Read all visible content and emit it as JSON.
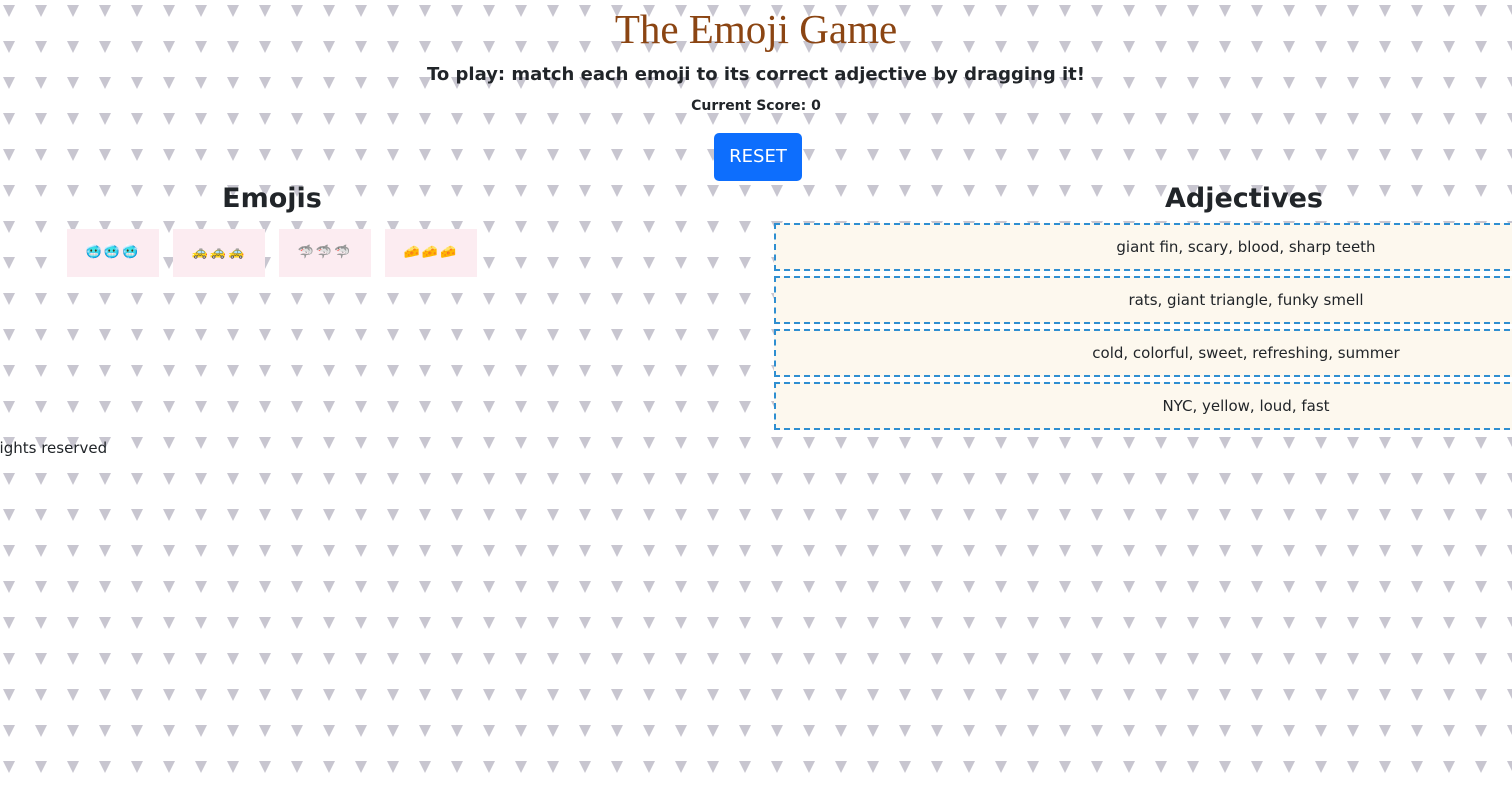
{
  "header": {
    "title": "The Emoji Game",
    "instructions": "To play: match each emoji to its correct adjective by dragging it!",
    "score": "Current Score: 0",
    "reset_label": "RESET"
  },
  "emojis": {
    "heading": "Emojis",
    "tiles": [
      {
        "text": "🥶🥶🥶",
        "name": "cold-face"
      },
      {
        "text": "🚕🚕🚕",
        "name": "taxi"
      },
      {
        "text": "🦈🦈🦈",
        "name": "shark"
      },
      {
        "text": "🧀🧀🧀",
        "name": "cheese"
      }
    ]
  },
  "adjectives": {
    "heading": "Adjectives",
    "items": [
      "giant fin, scary, blood, sharp teeth",
      "rats, giant triangle, funky smell",
      "cold, colorful, sweet, refreshing, summer",
      "NYC, yellow, loud, fast"
    ]
  },
  "footer": {
    "text": "All rights reserved"
  },
  "colors": {
    "title": "#8b4513",
    "reset_button": "#0d6efd",
    "emoji_tile": "#fcecf1",
    "adjective_box": "#fdf8ee",
    "adjective_border": "#2f8fd1"
  }
}
